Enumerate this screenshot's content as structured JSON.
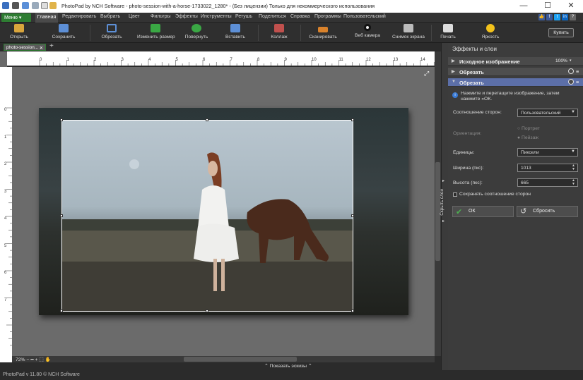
{
  "titlebar": {
    "title": "PhotoPad by NCH Software - photo-session-with-a-horse-1733022_1280* - (Без лицензии) Только для некоммерческого использования",
    "controls": [
      "—",
      "☐",
      "✕"
    ]
  },
  "menu": {
    "menu_button": "Меню ▾",
    "items": [
      "Главная",
      "Редактировать",
      "Выбрать",
      "Цвет",
      "Фильтры",
      "Эффекты",
      "Инструменты",
      "Ретушь",
      "Поделиться",
      "Справка",
      "Программы",
      "Пользовательский"
    ],
    "social": [
      "👍",
      "f",
      "t",
      "in",
      "?"
    ]
  },
  "toolbar": {
    "items": [
      "Открыть",
      "Сохранить",
      "Обрезать",
      "Изменить размер",
      "Повернуть",
      "Вставить",
      "Коллаж",
      "Сканировать",
      "Веб камера",
      "Снимок экрана",
      "Печать",
      "Яркость"
    ],
    "buy": "Купить"
  },
  "document_tab": {
    "label": "photo-session...",
    "close": "✕",
    "new": "+"
  },
  "rulers": {
    "h": [
      "0",
      "1",
      "2",
      "3",
      "4",
      "5",
      "6",
      "7",
      "8",
      "9",
      "10",
      "11",
      "12",
      "13",
      "14"
    ],
    "v": [
      "0",
      "1",
      "2",
      "3",
      "4",
      "5",
      "6",
      "7"
    ]
  },
  "bottom": {
    "zoom": "72%",
    "show_thumbs": "⌃ Показать эскизы ⌃"
  },
  "status": "PhotoPad v 11.80 © NCH Software",
  "collapse_label": "Скрыть слои",
  "panel": {
    "title": "Эффекты и слои",
    "layers": [
      {
        "name": "Исходное изображение",
        "extra": "100%"
      },
      {
        "name": "Обрезать"
      },
      {
        "name": "Обрезать"
      }
    ],
    "info": "Нажмите и перетащите изображение, затем нажмите «ОК.",
    "aspect_label": "Соотношение сторон:",
    "aspect_value": "Пользовательский",
    "orientation_label": "Ориентация:",
    "orientation_options": [
      "Портрет",
      "Пейзаж"
    ],
    "units_label": "Единицы:",
    "units_value": "Пиксели",
    "width_label": "Ширина (пкс):",
    "width_value": "1013",
    "height_label": "Высота (пкс):",
    "height_value": "665",
    "keep_ratio": "Сохранять соотношение сторон",
    "ok": "ОК",
    "reset": "Сбросить"
  },
  "colors": {
    "accent": "#2e7d32",
    "selected_layer": "#5c6fa8"
  }
}
